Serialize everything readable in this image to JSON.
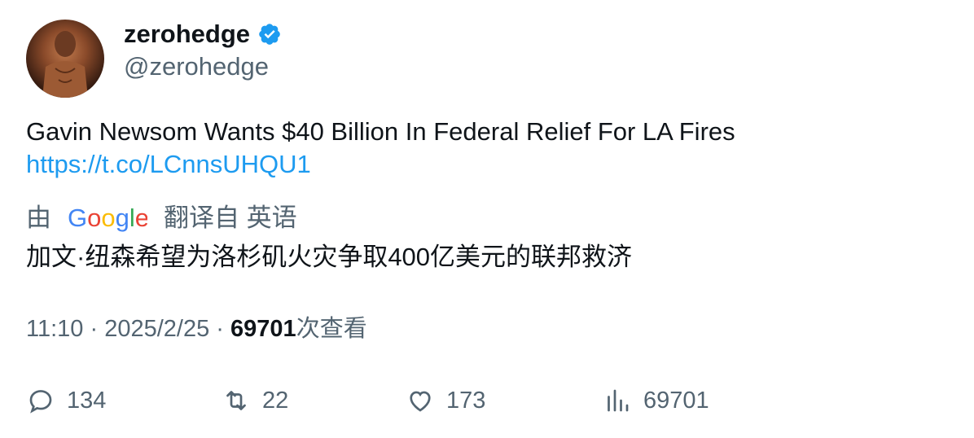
{
  "author": {
    "name": "zerohedge",
    "handle": "@zerohedge",
    "verified": true
  },
  "tweet": {
    "text": "Gavin Newsom Wants $40 Billion In Federal Relief For LA Fires",
    "link": "https://t.co/LCnnsUHQU1"
  },
  "translation": {
    "prefix": "由",
    "brand": "Google",
    "suffix": "翻译自 英语",
    "text": "加文·纽森希望为洛杉矶火灾争取400亿美元的联邦救济"
  },
  "meta": {
    "time": "11:10",
    "separator": "·",
    "date": "2025/2/25",
    "views": "69701",
    "views_suffix": "次查看"
  },
  "actions": {
    "replies": "134",
    "retweets": "22",
    "likes": "173",
    "views": "69701"
  },
  "colors": {
    "verified_blue": "#1d9bf0",
    "link_blue": "#1d9bf0",
    "secondary_text": "#536471",
    "primary_text": "#0f1419"
  }
}
